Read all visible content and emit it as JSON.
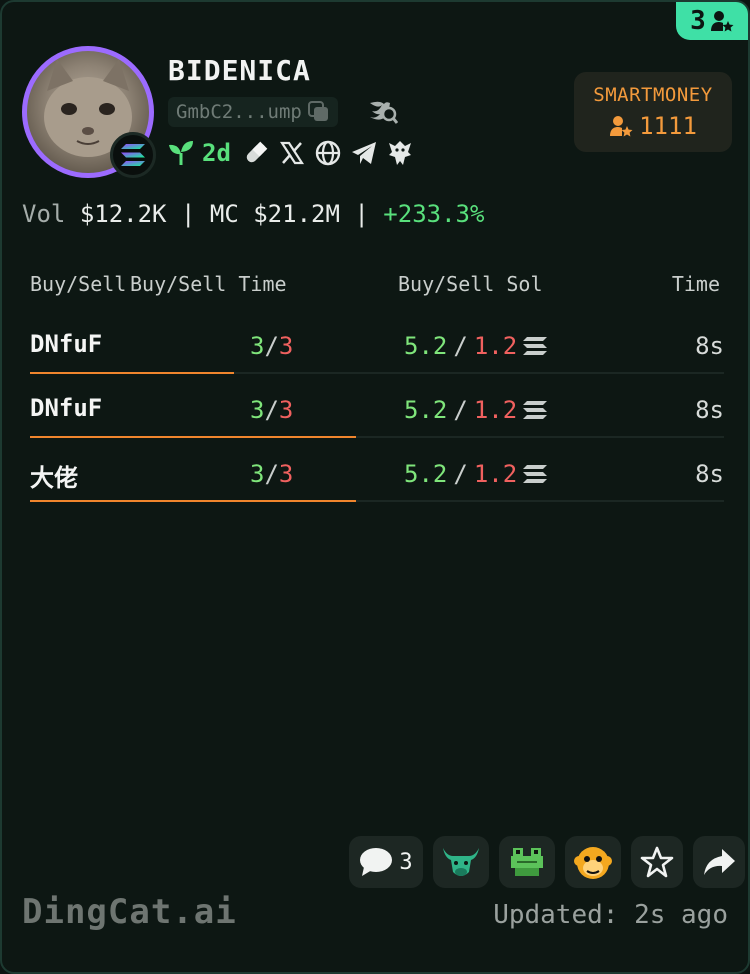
{
  "corner_badge": {
    "count": "3"
  },
  "token": {
    "name": "BIDENICA",
    "address": "GmbC2...ump",
    "age": "2d"
  },
  "smartmoney": {
    "label": "SMARTMONEY",
    "count": "1111"
  },
  "stats": {
    "vol_label": "Vol",
    "vol_value": "$12.2K",
    "sep1": "|",
    "mc_label": "MC",
    "mc_value": "$21.2M",
    "sep2": "|",
    "change": "+233.3%"
  },
  "table": {
    "headers": [
      "Buy/Sell",
      "Buy/Sell Time",
      "Buy/Sell Sol",
      "Time"
    ],
    "rows": [
      {
        "maker": "DNfuF",
        "buys": "3",
        "sells": "3",
        "buy_sol": "5.2",
        "sell_sol": "1.2",
        "time": "8s"
      },
      {
        "maker": "DNfuF",
        "buys": "3",
        "sells": "3",
        "buy_sol": "5.2",
        "sell_sol": "1.2",
        "time": "8s"
      },
      {
        "maker": "大佬",
        "buys": "3",
        "sells": "3",
        "buy_sol": "5.2",
        "sell_sol": "1.2",
        "time": "8s"
      }
    ]
  },
  "actions": {
    "comments_count": "3"
  },
  "footer": {
    "brand": "DingCat.ai",
    "updated": "Updated: 2s ago"
  },
  "colors": {
    "accent_green": "#3fe0a6",
    "buy_green": "#7fe57b",
    "sell_red": "#f0615f",
    "smartmoney_orange": "#f39a3c",
    "underline_orange": "#f0852d",
    "avatar_ring": "#9c6bff"
  },
  "icons": [
    "user-star-icon",
    "solana-icon",
    "copy-icon",
    "search-x-icon",
    "sprout-icon",
    "pill-icon",
    "x-logo-icon",
    "globe-icon",
    "telegram-icon",
    "eagle-icon",
    "solana-lines-icon",
    "chat-icon",
    "bull-icon",
    "frog-icon",
    "monkey-icon",
    "star-icon",
    "share-icon"
  ]
}
